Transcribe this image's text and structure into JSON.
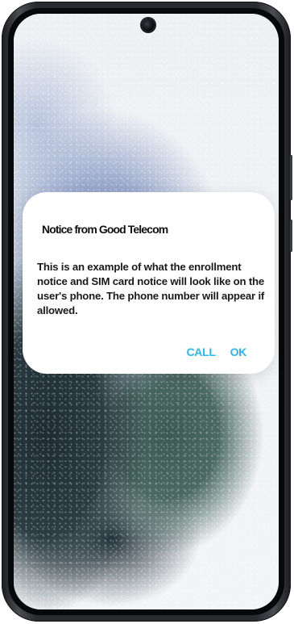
{
  "dialog": {
    "title": "Notice from Good Telecom",
    "body": "This is an example of what the enrollment notice and SIM card notice will look like on the user's phone. The phone number will appear if allowed.",
    "actions": {
      "call_label": "CALL",
      "ok_label": "OK"
    }
  },
  "colors": {
    "accent": "#29b6f6",
    "dialog_bg": "#ffffff",
    "phone_frame": "#2a2b2f"
  },
  "icons": {
    "camera": "front-camera-icon"
  }
}
